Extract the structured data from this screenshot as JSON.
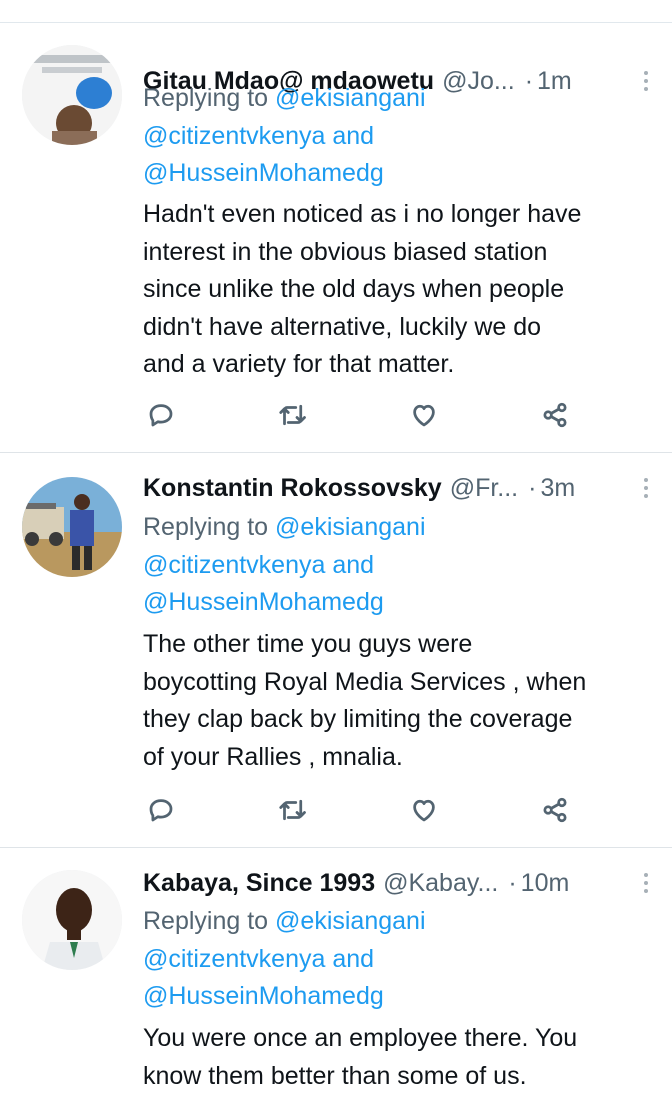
{
  "tweets": [
    {
      "name": "Gitau Mdao@ mdaowetu",
      "handle": "@Jo...",
      "time": "1m",
      "replying_label": "Replying to",
      "mention1": "@ekisiangani",
      "mention2": "@citizentvkenya",
      "and_label": "and",
      "mention3": "@HusseinMohamedg",
      "text_lines": [
        "Hadn't even noticed as i no longer have",
        "interest in the obvious biased station",
        "since unlike the old days when people",
        "didn't have alternative, luckily  we do",
        "and a variety for that matter."
      ],
      "icons": {
        "reply": "reply-icon",
        "retweet": "retweet-icon",
        "like": "heart-icon",
        "share": "share-icon"
      }
    },
    {
      "name": "Konstantin Rokossovsky",
      "handle": "@Fr...",
      "time": "3m",
      "replying_label": "Replying to",
      "mention1": "@ekisiangani",
      "mention2": "@citizentvkenya",
      "and_label": "and",
      "mention3": "@HusseinMohamedg",
      "text_lines": [
        "The other time you guys were",
        "boycotting Royal Media Services  , when",
        "they clap back by limiting the coverage",
        "of your Rallies  , mnalia."
      ],
      "icons": {
        "reply": "reply-icon",
        "retweet": "retweet-icon",
        "like": "heart-icon",
        "share": "share-icon"
      }
    },
    {
      "name": "Kabaya, Since 1993",
      "handle": "@Kabay...",
      "time": "10m",
      "replying_label": "Replying to",
      "mention1": "@ekisiangani",
      "mention2": "@citizentvkenya",
      "and_label": "and",
      "mention3": "@HusseinMohamedg",
      "text_lines": [
        "You were once an employee there. You",
        "know them better than some of us."
      ]
    }
  ],
  "dot_separator": "·",
  "colors": {
    "link": "#1d9bf0",
    "muted": "#536471",
    "text": "#0f1419"
  }
}
